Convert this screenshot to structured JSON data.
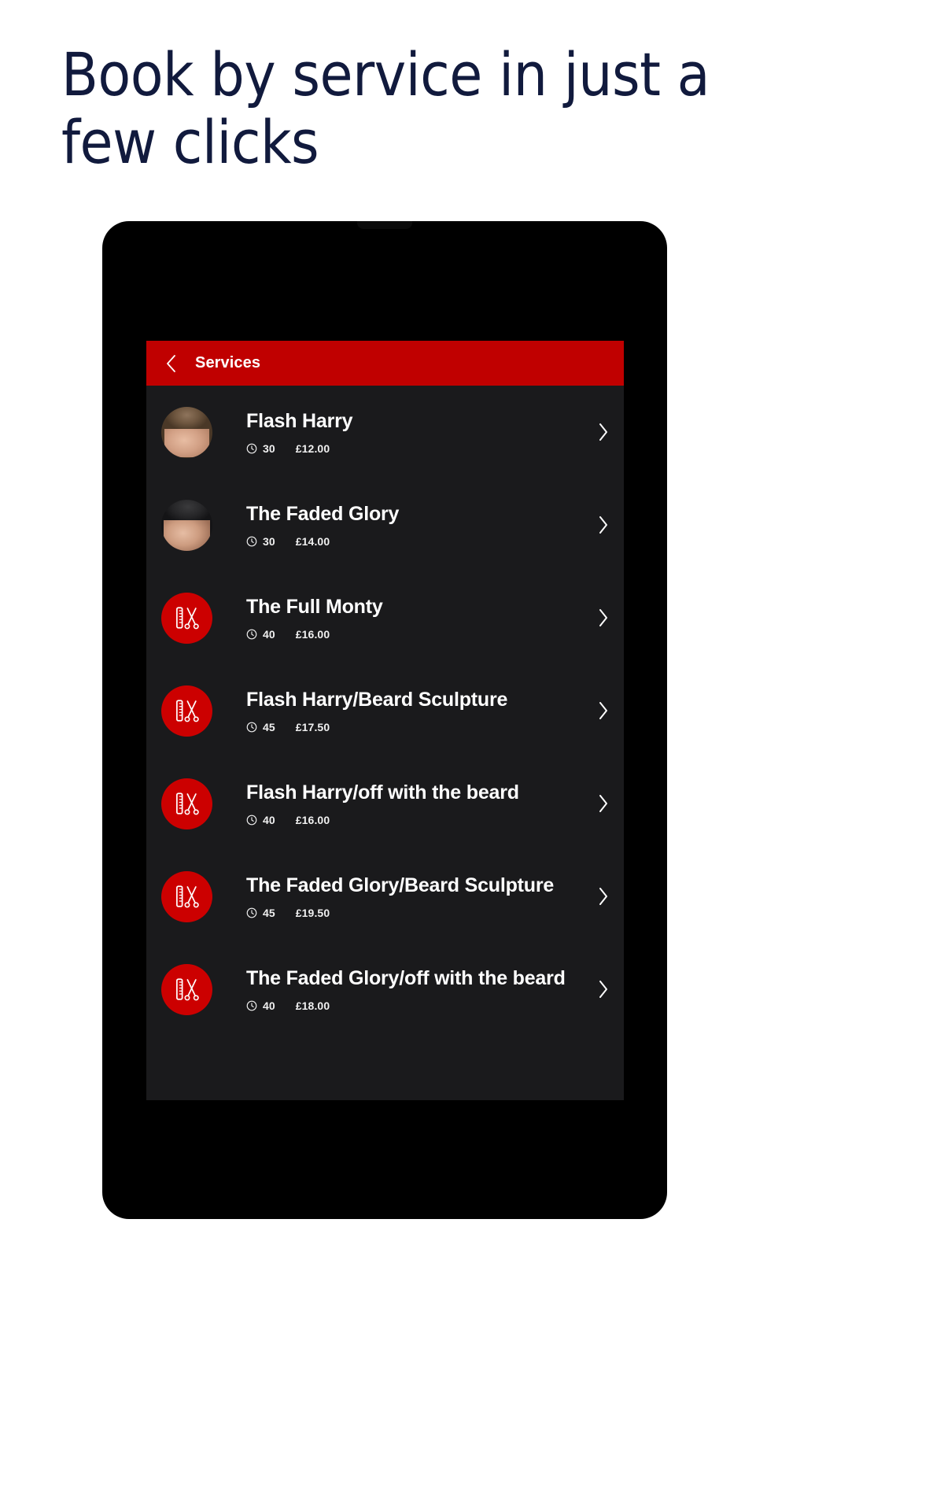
{
  "page": {
    "headline": "Book by service in just a few clicks",
    "background_color": "#ffffff",
    "headline_color": "#111a3d"
  },
  "device": {
    "frame_color": "#000000",
    "screen_background": "#1a1a1c"
  },
  "app": {
    "header": {
      "title": "Services",
      "background_color": "#c00000",
      "text_color": "#ffffff",
      "back_icon": "chevron-left-icon"
    },
    "accent_color": "#cc0000",
    "list_background": "#1a1a1c",
    "services": [
      {
        "name": "Flash Harry",
        "duration": "30",
        "price": "£12.00",
        "avatar_type": "photo",
        "avatar_name": "haircut-photo-1",
        "clock_icon": "clock-icon",
        "chevron_icon": "chevron-right-icon"
      },
      {
        "name": "The Faded Glory",
        "duration": "30",
        "price": "£14.00",
        "avatar_type": "photo",
        "avatar_name": "haircut-photo-2",
        "clock_icon": "clock-icon",
        "chevron_icon": "chevron-right-icon"
      },
      {
        "name": "The Full Monty",
        "duration": "40",
        "price": "£16.00",
        "avatar_type": "icon",
        "avatar_name": "comb-scissors-icon",
        "clock_icon": "clock-icon",
        "chevron_icon": "chevron-right-icon"
      },
      {
        "name": "Flash Harry/Beard Sculpture",
        "duration": "45",
        "price": "£17.50",
        "avatar_type": "icon",
        "avatar_name": "comb-scissors-icon",
        "clock_icon": "clock-icon",
        "chevron_icon": "chevron-right-icon"
      },
      {
        "name": "Flash Harry/off with the beard",
        "duration": "40",
        "price": "£16.00",
        "avatar_type": "icon",
        "avatar_name": "comb-scissors-icon",
        "clock_icon": "clock-icon",
        "chevron_icon": "chevron-right-icon"
      },
      {
        "name": "The Faded Glory/Beard Sculpture",
        "duration": "45",
        "price": "£19.50",
        "avatar_type": "icon",
        "avatar_name": "comb-scissors-icon",
        "clock_icon": "clock-icon",
        "chevron_icon": "chevron-right-icon"
      },
      {
        "name": "The Faded Glory/off with the beard",
        "duration": "40",
        "price": "£18.00",
        "avatar_type": "icon",
        "avatar_name": "comb-scissors-icon",
        "clock_icon": "clock-icon",
        "chevron_icon": "chevron-right-icon"
      }
    ]
  }
}
